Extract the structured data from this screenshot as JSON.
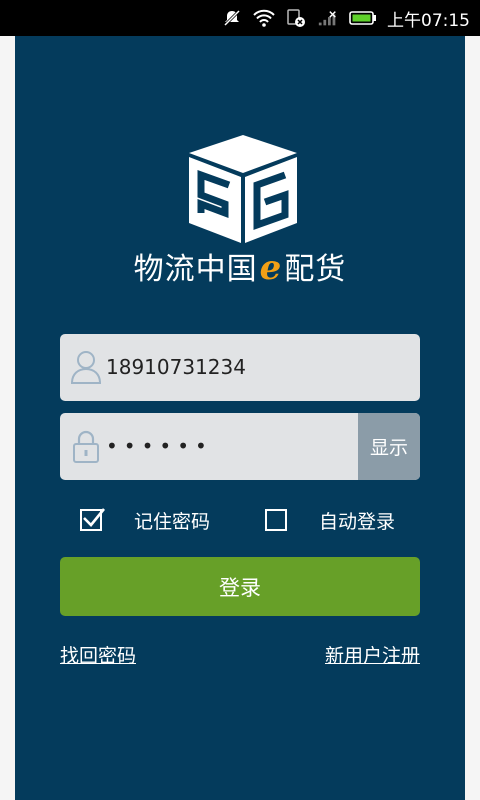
{
  "status_bar": {
    "time": "上午07:15",
    "icons": [
      "mute-icon",
      "wifi-icon",
      "notification-icon",
      "signal-icon",
      "battery-icon"
    ]
  },
  "brand": {
    "name_prefix": "物流中国",
    "name_e": "e",
    "name_suffix": "配货",
    "logo_text": "56",
    "colors": {
      "background": "#043b5c",
      "accent": "#f2a016",
      "button": "#67a028"
    }
  },
  "login_form": {
    "username_value": "18910731234",
    "password_value": "••••••",
    "show_password_label": "显示",
    "remember_password_label": "记住密码",
    "remember_password_checked": true,
    "auto_login_label": "自动登录",
    "auto_login_checked": false,
    "login_button_label": "登录"
  },
  "links": {
    "forgot_password": "找回密码",
    "register": "新用户注册"
  }
}
